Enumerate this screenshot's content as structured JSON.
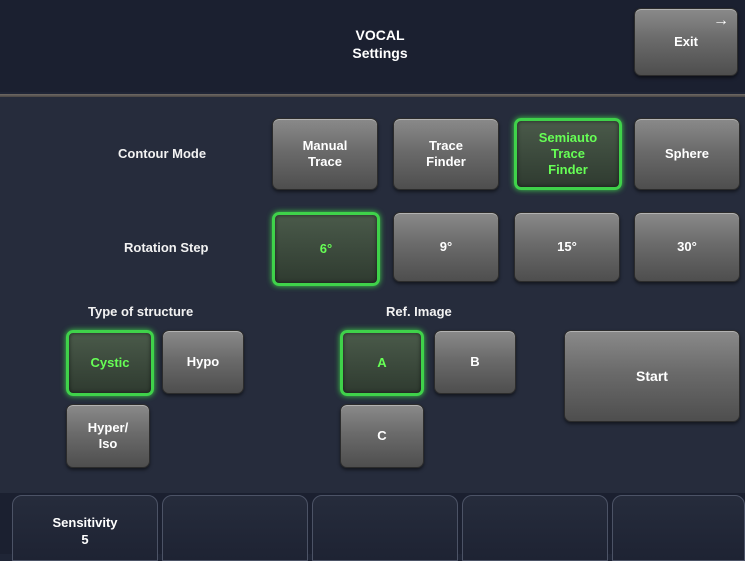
{
  "header": {
    "title": "VOCAL\nSettings",
    "exit_label": "Exit",
    "exit_arrow": "→"
  },
  "contour_mode": {
    "label": "Contour Mode",
    "options": [
      "Manual\nTrace",
      "Trace\nFinder",
      "Semiauto\nTrace\nFinder",
      "Sphere"
    ],
    "selected": "Semiauto\nTrace\nFinder"
  },
  "rotation_step": {
    "label": "Rotation Step",
    "options": [
      "6°",
      "9°",
      "15°",
      "30°"
    ],
    "selected": "6°"
  },
  "structure": {
    "label": "Type of structure",
    "options": [
      "Cystic",
      "Hypo",
      "Hyper/\nIso"
    ],
    "selected": "Cystic"
  },
  "ref_image": {
    "label": "Ref. Image",
    "options": [
      "A",
      "B",
      "C"
    ],
    "selected": "A"
  },
  "start_label": "Start",
  "bottom_tabs": [
    "Sensitivity\n5",
    "",
    "",
    "",
    ""
  ],
  "colors": {
    "background": "#262c3c",
    "active_border": "#3fd24a",
    "active_text": "#66ff55",
    "button": "#6b6b6b"
  }
}
